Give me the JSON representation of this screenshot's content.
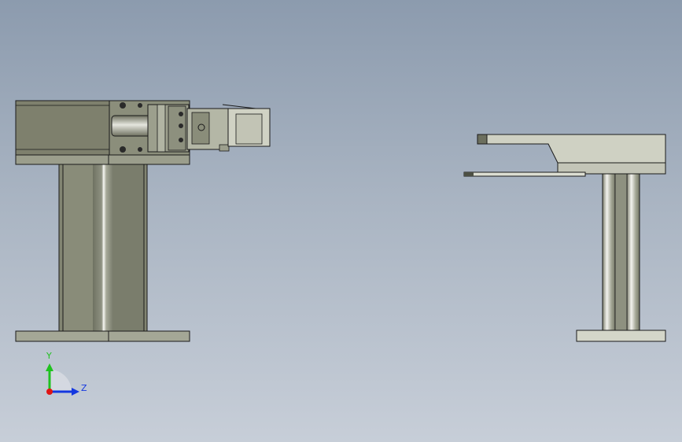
{
  "viewport": {
    "background_top": "#8c9bae",
    "background_bottom": "#c7ced8"
  },
  "model": {
    "body_dark": "#7d7f6e",
    "body_mid": "#a2a594",
    "body_light": "#cfd1c2",
    "edge": "#1a1a1a",
    "rod_highlight": "#f4f4ee"
  },
  "triad": {
    "y_label": "Y",
    "z_label": "Z",
    "y_color": "#1fc21f",
    "z_color": "#1437e0",
    "x_color": "#e01414",
    "icon": "coordinate-triad-icon"
  }
}
